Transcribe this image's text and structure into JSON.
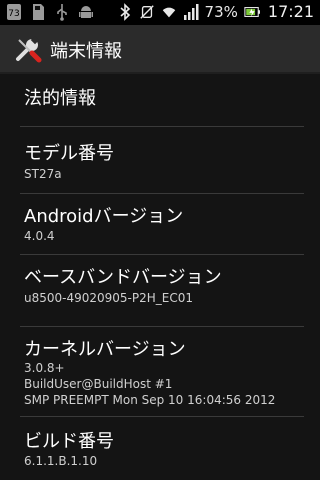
{
  "status_bar": {
    "notification_count": "73",
    "battery_percent": "73%",
    "time": "17:21",
    "icons": [
      "notification-badge-icon",
      "sd-card-icon",
      "usb-icon",
      "android-debug-icon",
      "bluetooth-icon",
      "silent-mode-icon",
      "wifi-icon",
      "signal-icon",
      "battery-icon"
    ]
  },
  "action_bar": {
    "title": "端末情報",
    "icon": "settings-tools-icon"
  },
  "items": [
    {
      "title": "法的情報",
      "summary": ""
    },
    {
      "title": "モデル番号",
      "summary": "ST27a"
    },
    {
      "title": "Androidバージョン",
      "summary": "4.0.4"
    },
    {
      "title": "ベースバンドバージョン",
      "summary": "u8500-49020905-P2H_EC01"
    },
    {
      "title": "カーネルバージョン",
      "summary_lines": [
        "3.0.8+",
        "BuildUser@BuildHost #1",
        "SMP PREEMPT Mon Sep 10 16:04:56 2012"
      ]
    },
    {
      "title": "ビルド番号",
      "summary": "6.1.1.B.1.10"
    }
  ],
  "colors": {
    "background": "#141414",
    "action_bar": "#2b2b2b",
    "divider": "#3a3a3a",
    "battery_fill": "#7ecb3a"
  }
}
